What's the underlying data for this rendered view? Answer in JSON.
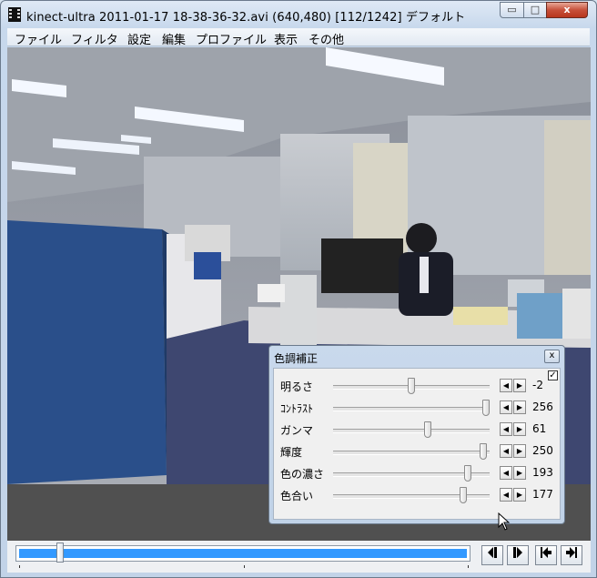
{
  "window": {
    "title": "kinect-ultra 2011-01-17 18-38-36-32.avi (640,480)  [112/1242]  デフォルト",
    "icon": "film-icon",
    "caption_buttons": {
      "minimize": "▭",
      "maximize": "□",
      "close": "x"
    }
  },
  "menu": [
    "ファイル",
    "フィルタ",
    "設定",
    "編集",
    "プロファイル",
    "表示",
    "その他"
  ],
  "player": {
    "current_frame": 112,
    "total_frames": 1242,
    "position_fraction": 0.09,
    "nav_buttons": [
      "prev-frame-icon",
      "next-frame-icon",
      "go-start-icon",
      "go-end-icon"
    ],
    "colors": {
      "seek_fill": "#3399ff",
      "panel": "#505050"
    }
  },
  "dialog": {
    "title": "色調補正",
    "close_label": "x",
    "enabled_check": "✓",
    "rows": [
      {
        "label": "明るさ",
        "value": "-2",
        "level": 0.5
      },
      {
        "label": "ｺﾝﾄﾗｽﾄ",
        "value": "256",
        "level": 1.0
      },
      {
        "label": "ガンマ",
        "value": "61",
        "level": 0.61
      },
      {
        "label": "輝度",
        "value": "250",
        "level": 0.98
      },
      {
        "label": "色の濃さ",
        "value": "193",
        "level": 0.88
      },
      {
        "label": "色合い",
        "value": "177",
        "level": 0.85
      }
    ],
    "step_left": "◀",
    "step_right": "▶"
  }
}
